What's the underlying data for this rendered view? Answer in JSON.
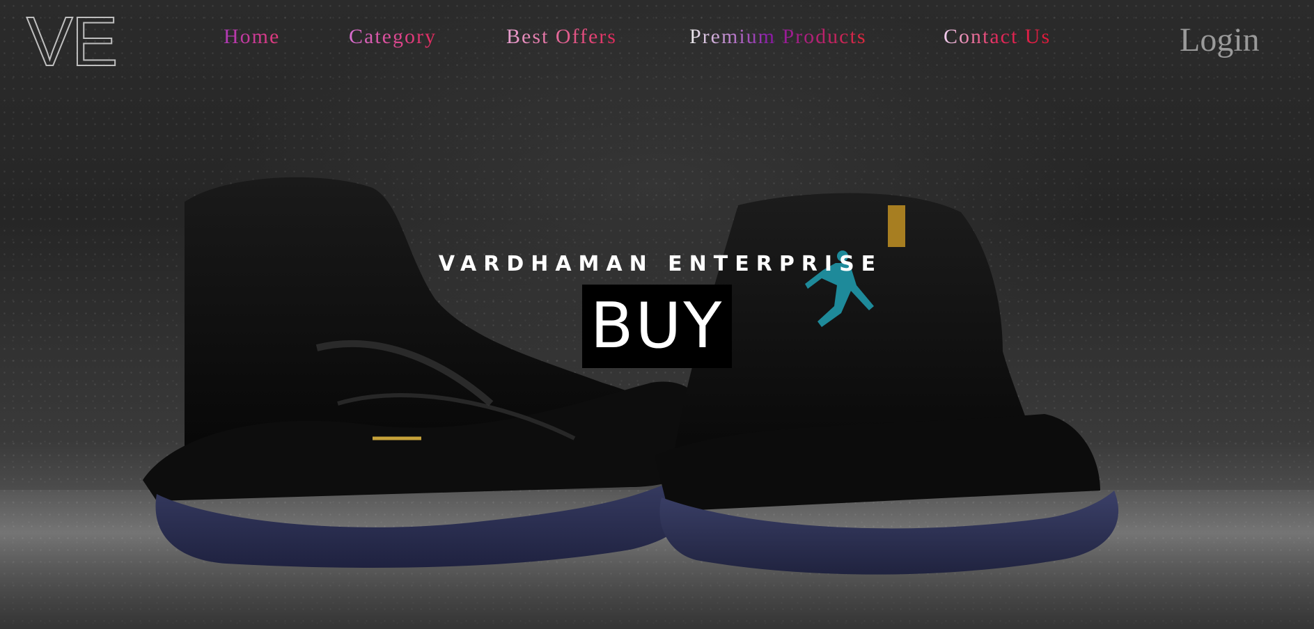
{
  "logo": {
    "text": "VE"
  },
  "nav": {
    "items": [
      {
        "label": "Home"
      },
      {
        "label": "Category"
      },
      {
        "label": "Best Offers"
      },
      {
        "label": "Premium Products"
      },
      {
        "label": "Contact Us"
      }
    ],
    "login_label": "Login"
  },
  "hero": {
    "brand": "VARDHAMAN ENTERPRISE",
    "cta_label": "BUY"
  },
  "colors": {
    "background": "#1a1a1a",
    "cta_background": "#000000",
    "cta_text": "#ffffff",
    "login_text": "#9a9a9a",
    "nav_gradient_start": "#b03ab8",
    "nav_gradient_end": "#e0285a"
  }
}
